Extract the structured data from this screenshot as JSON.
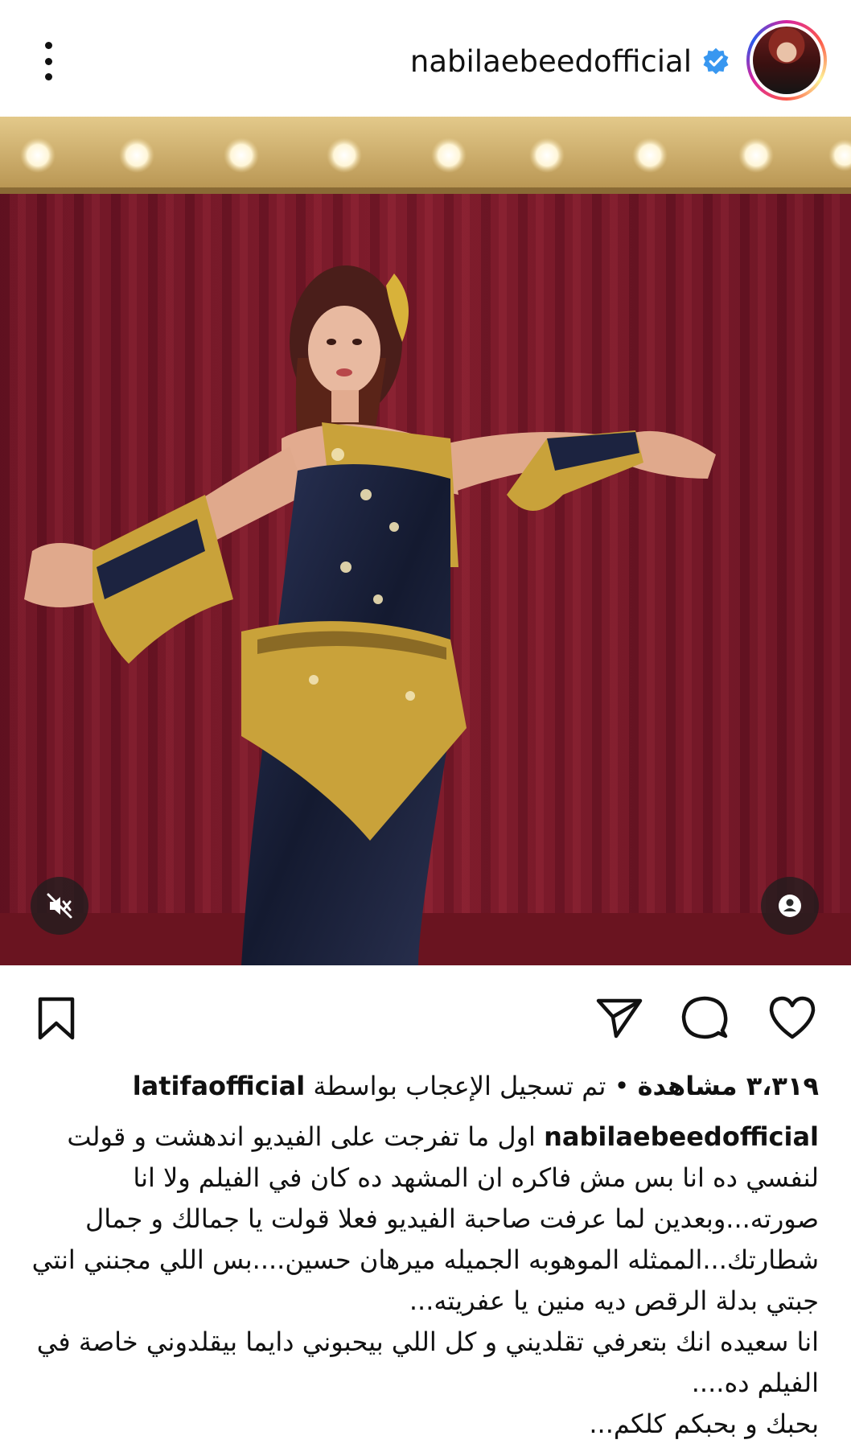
{
  "header": {
    "username": "nabilaebeedofficial",
    "verified_icon": "verified-badge-icon",
    "menu_icon": "more-options-icon",
    "avatar_icon": "profile-avatar"
  },
  "media": {
    "type": "video",
    "mute_icon": "muted-speaker-icon",
    "tag_icon": "tagged-user-icon"
  },
  "actions": {
    "like_icon": "heart-icon",
    "comment_icon": "comment-bubble-icon",
    "share_icon": "send-paper-plane-icon",
    "save_icon": "bookmark-icon"
  },
  "stats": {
    "views": "٣،٣١٩ مشاهدة",
    "separator": "•",
    "liked_by_prefix": "تم تسجيل الإعجاب بواسطة",
    "liked_by_user": "latifaofficial"
  },
  "caption": {
    "author": "nabilaebeedofficial",
    "lines": [
      "اول ما تفرجت على الفيديو اندهشت و قولت",
      "لنفسي ده انا بس مش فاكره ان المشهد ده كان في الفيلم ولا انا",
      "صورته...وبعدين لما عرفت صاحبة الفيديو فعلا قولت يا جمالك و جمال",
      "شطارتك...الممثله الموهوبه الجميله ميرهان حسين....بس اللي مجنني انتي",
      "جبتي بدلة الرقص ديه منين يا عفريته...",
      "انا سعيده انك بتعرفي تقلديني و كل اللي بيحبوني دايما بيقلدوني خاصة في",
      "الفيلم ده....",
      "بحبك و بحبكم كلكم..."
    ]
  },
  "colors": {
    "curtain": "#7a1a2a",
    "accent_blue": "#3897f0",
    "costume_gold": "#c9a23a",
    "costume_navy": "#1c2340"
  }
}
